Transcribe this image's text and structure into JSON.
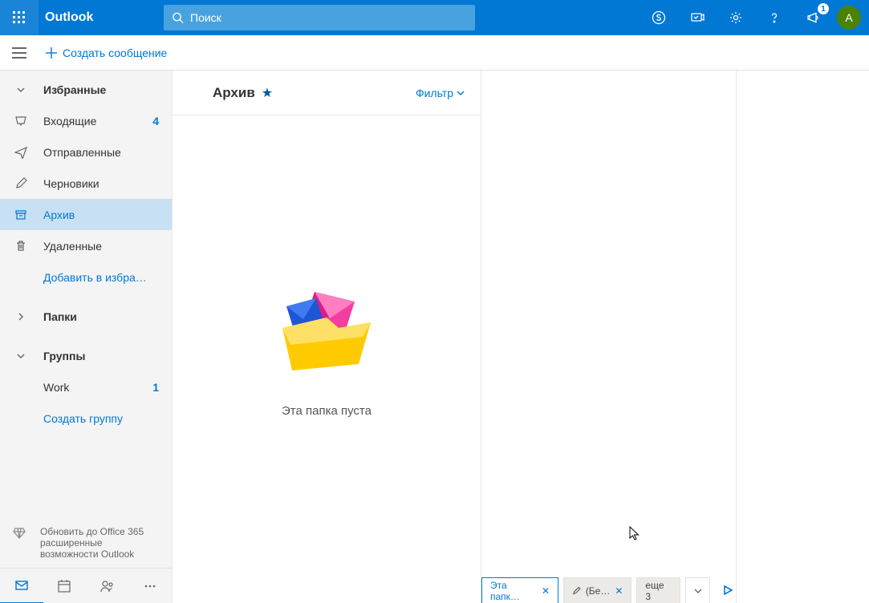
{
  "header": {
    "app_name": "Outlook",
    "search_placeholder": "Поиск",
    "notif_badge": "1",
    "avatar_initial": "A"
  },
  "cmdbar": {
    "new_message": "Создать сообщение"
  },
  "sidebar": {
    "favorites_label": "Избранные",
    "inbox": {
      "label": "Входящие",
      "count": "4"
    },
    "sent": {
      "label": "Отправленные"
    },
    "drafts": {
      "label": "Черновики"
    },
    "archive": {
      "label": "Архив"
    },
    "deleted": {
      "label": "Удаленные"
    },
    "add_fav": "Добавить в избра…",
    "folders_label": "Папки",
    "groups_label": "Группы",
    "group_work": {
      "label": "Work",
      "count": "1"
    },
    "create_group": "Создать группу",
    "upgrade": "Обновить до Office 365 расширенные возможности Outlook"
  },
  "list": {
    "title": "Архив",
    "filter": "Фильтр",
    "empty_msg": "Эта папка пуста"
  },
  "tabs": {
    "t1": "Эта папк…",
    "t2": "(Бе…",
    "t3": "еще 3"
  }
}
